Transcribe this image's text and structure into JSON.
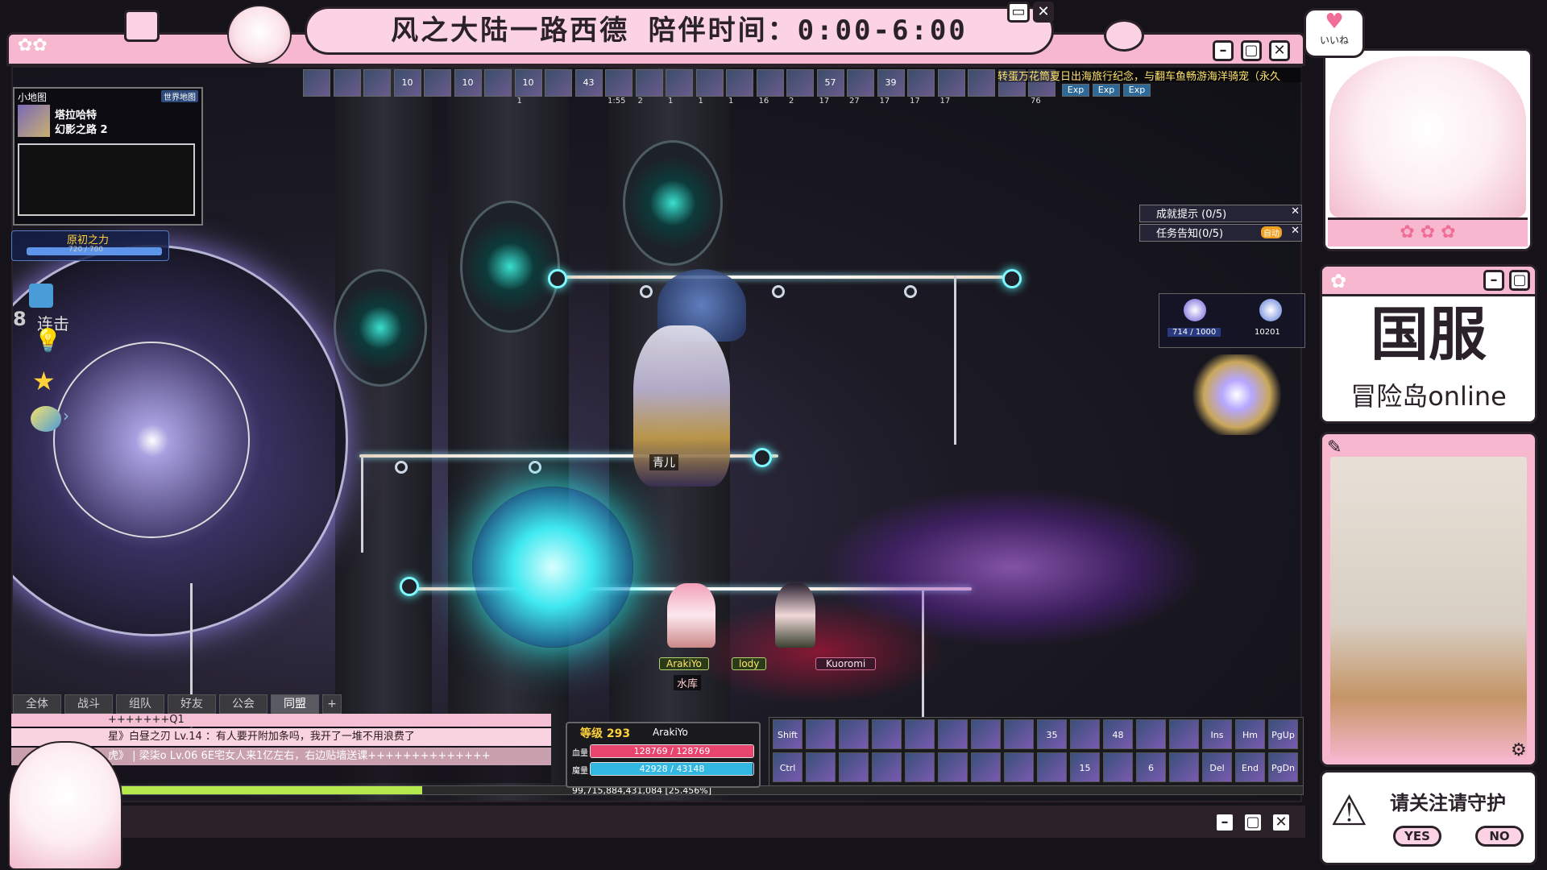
{
  "stream": {
    "title": "风之大陆一路西德  陪伴时间：0:00-6:00",
    "server_label": "国服",
    "game_label": "冒险岛online",
    "follow_prompt": "请关注请守护",
    "yes_label": "YES",
    "no_label": "NO",
    "like_label": "いいね"
  },
  "minimap": {
    "header": "小地图",
    "world_btn": "世界地图",
    "region": "塔拉哈特",
    "map_name": "幻影之路 2"
  },
  "primal_power": {
    "label": "原初之力",
    "value": "720 / 700",
    "ratio": 1.0
  },
  "combo": {
    "count": "8",
    "label": "连击"
  },
  "buffs": {
    "counts": [
      "",
      "",
      "",
      "10",
      "",
      "10",
      "",
      "10",
      "",
      "43",
      "",
      "",
      "",
      "",
      "",
      "",
      "",
      "57",
      "",
      "39",
      "",
      "",
      "",
      "",
      ""
    ],
    "subs": [
      "",
      "",
      "",
      "",
      "",
      "",
      "",
      "1",
      "",
      "",
      "1:55",
      "2",
      "1",
      "1",
      "1",
      "16",
      "2",
      "17",
      "27",
      "17",
      "17",
      "17",
      "",
      "",
      "76"
    ],
    "scroll_text": "转蛋万花筒夏日出海旅行纪念，与翻车鱼畅游海洋骑宠（永久",
    "exp_labels": [
      "Exp",
      "Exp",
      "Exp"
    ]
  },
  "quest_panel": {
    "achievement": "成就提示 (0/5)",
    "quest": "任务告知(0/5)",
    "auto_label": "自动"
  },
  "gauges": {
    "left_value": "714 / 1000",
    "right_value": "10201"
  },
  "characters": {
    "npc_name": "青儿",
    "player_name": "ArakiYo",
    "guild": "水库",
    "pet1": "lody",
    "pet2": "Kuoromi"
  },
  "chat": {
    "tabs": [
      "全体",
      "战斗",
      "组队",
      "好友",
      "公会",
      "同盟",
      "+"
    ],
    "lines": [
      "+++++++Q1",
      "星》白昼之刃  Lv.14  ：有人要开附加条吗，我开了一堆不用浪费了",
      "虎》    | 梁柒o   Lv.06  6E宅女人来1亿左右，右边贴墙送课++++++++++++++"
    ]
  },
  "status": {
    "level_label": "等级 293",
    "name": "ArakiYo",
    "hp_label": "血量",
    "mp_label": "魔量",
    "hp_value": "128769 / 128769",
    "mp_value": "42928 / 43148",
    "hp_ratio": 1.0,
    "mp_ratio": 0.995,
    "exp_text": "99,715,884,431,084 [25.456%]",
    "exp_ratio": 0.25456
  },
  "skills": {
    "row1": [
      "Shift",
      "",
      "",
      "",
      "",
      "",
      "",
      "",
      "35",
      "",
      "48",
      "",
      "",
      "Ins",
      "Hm",
      "PgUp"
    ],
    "row2": [
      "Ctrl",
      "",
      "",
      "",
      "",
      "",
      "",
      "",
      "",
      "15",
      "",
      "6",
      "",
      "Del",
      "End",
      "PgDn"
    ]
  },
  "colors": {
    "frame_pink": "#f7b8cf",
    "frame_dark": "#2a2228",
    "accent_pink": "#f06d97",
    "hp": "#e8456e",
    "mp": "#31b7e0",
    "exp": "#b5e84d"
  }
}
